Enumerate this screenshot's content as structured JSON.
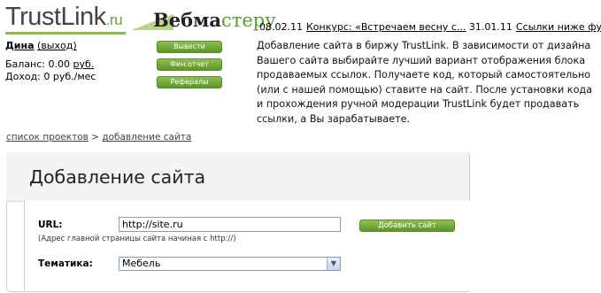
{
  "logo": {
    "main": "TrustLink",
    "suffix": ".ru",
    "partner_part1": "Вебма",
    "partner_part2": "стеру"
  },
  "news": [
    {
      "date": "08.02.11",
      "text": "Конкурс: «Встречаем весну с..."
    },
    {
      "date": "31.01.11",
      "text": "Ссылки ниже футера"
    }
  ],
  "user": {
    "name": "Дина",
    "logout": "(выход)",
    "balance_label": "Баланс:",
    "balance_value": "0.00",
    "balance_unit": "руб.",
    "income_label": "Доход:",
    "income_value": "0 руб./мес"
  },
  "buttons": {
    "withdraw": "Вывести",
    "fin_report": "Фин.отчет",
    "referrals": "Рефералы"
  },
  "description": "Добавление сайта в биржу TrustLink. В зависимости от дизайна Вашего сайта выбирайте лучший вариант отображения блока продаваемых ссылок. Получаете код, который самостоятельно (или с нашей помощью) ставите на сайт. После установки кода и прохождения ручной модерации TrustLink будет продавать ссылки, а Вы зарабатываете.",
  "breadcrumb": {
    "item1": "список проектов",
    "sep": ">",
    "item2": "добавление сайта"
  },
  "panel": {
    "title": "Добавление сайта",
    "url_label": "URL:",
    "url_value": "http://site.ru",
    "url_hint": "(Адрес главной страницы сайта начиная с http://)",
    "add_button": "Добавить сайт",
    "topic_label": "Тематика:",
    "topic_value": "Мебель"
  },
  "colors": {
    "accent_green": "#6aa42e",
    "button_green": "#5e9626",
    "panel_bg": "#f4f4f4"
  }
}
